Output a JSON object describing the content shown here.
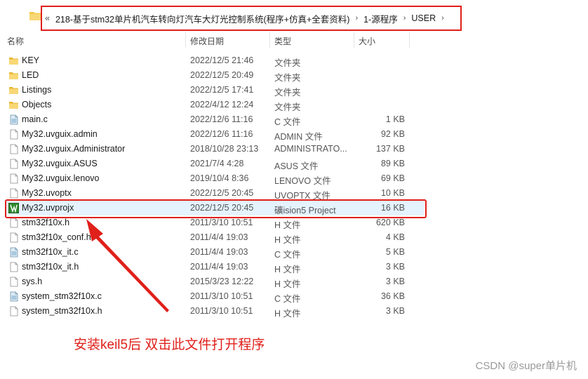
{
  "breadcrumb": {
    "back_chevron": "«",
    "items": [
      "218-基于stm32单片机汽车转向灯汽车大灯光控制系统(程序+仿真+全套资料)",
      "1-源程序",
      "USER"
    ],
    "separator": "›"
  },
  "columns": {
    "name": "名称",
    "date": "修改日期",
    "type": "类型",
    "size": "大小"
  },
  "files": [
    {
      "name": "KEY",
      "date": "2022/12/5 21:46",
      "type": "文件夹",
      "size": "",
      "icon": "folder-icon"
    },
    {
      "name": "LED",
      "date": "2022/12/5 20:49",
      "type": "文件夹",
      "size": "",
      "icon": "folder-icon"
    },
    {
      "name": "Listings",
      "date": "2022/12/5 17:41",
      "type": "文件夹",
      "size": "",
      "icon": "folder-icon"
    },
    {
      "name": "Objects",
      "date": "2022/4/12 12:24",
      "type": "文件夹",
      "size": "",
      "icon": "folder-icon"
    },
    {
      "name": "main.c",
      "date": "2022/12/6 11:16",
      "type": "C 文件",
      "size": "1 KB",
      "icon": "c-file-icon"
    },
    {
      "name": "My32.uvguix.admin",
      "date": "2022/12/6 11:16",
      "type": "ADMIN 文件",
      "size": "92 KB",
      "icon": "file-icon"
    },
    {
      "name": "My32.uvguix.Administrator",
      "date": "2018/10/28 23:13",
      "type": "ADMINISTRATO...",
      "size": "137 KB",
      "icon": "file-icon"
    },
    {
      "name": "My32.uvguix.ASUS",
      "date": "2021/7/4 4:28",
      "type": "ASUS 文件",
      "size": "89 KB",
      "icon": "file-icon"
    },
    {
      "name": "My32.uvguix.lenovo",
      "date": "2019/10/4 8:36",
      "type": "LENOVO 文件",
      "size": "69 KB",
      "icon": "file-icon"
    },
    {
      "name": "My32.uvoptx",
      "date": "2022/12/5 20:45",
      "type": "UVOPTX 文件",
      "size": "10 KB",
      "icon": "file-icon"
    },
    {
      "name": "My32.uvprojx",
      "date": "2022/12/5 20:45",
      "type": "礦ision5 Project",
      "size": "16 KB",
      "icon": "keil-project-icon",
      "selected": true
    },
    {
      "name": "stm32f10x.h",
      "date": "2011/3/10 10:51",
      "type": "H 文件",
      "size": "620 KB",
      "icon": "file-icon"
    },
    {
      "name": "stm32f10x_conf.h",
      "date": "2011/4/4 19:03",
      "type": "H 文件",
      "size": "4 KB",
      "icon": "file-icon"
    },
    {
      "name": "stm32f10x_it.c",
      "date": "2011/4/4 19:03",
      "type": "C 文件",
      "size": "5 KB",
      "icon": "c-file-icon"
    },
    {
      "name": "stm32f10x_it.h",
      "date": "2011/4/4 19:03",
      "type": "H 文件",
      "size": "3 KB",
      "icon": "file-icon"
    },
    {
      "name": "sys.h",
      "date": "2015/3/23 12:22",
      "type": "H 文件",
      "size": "3 KB",
      "icon": "file-icon"
    },
    {
      "name": "system_stm32f10x.c",
      "date": "2011/3/10 10:51",
      "type": "C 文件",
      "size": "36 KB",
      "icon": "c-file-icon"
    },
    {
      "name": "system_stm32f10x.h",
      "date": "2011/3/10 10:51",
      "type": "H 文件",
      "size": "3 KB",
      "icon": "file-icon"
    }
  ],
  "annotation": "安装keil5后 双击此文件打开程序",
  "watermark": "CSDN @super单片机",
  "colors": {
    "annotation_red": "#e0201a",
    "selection_bg": "#e5f3ff",
    "folder_yellow": "#f4c94c"
  }
}
